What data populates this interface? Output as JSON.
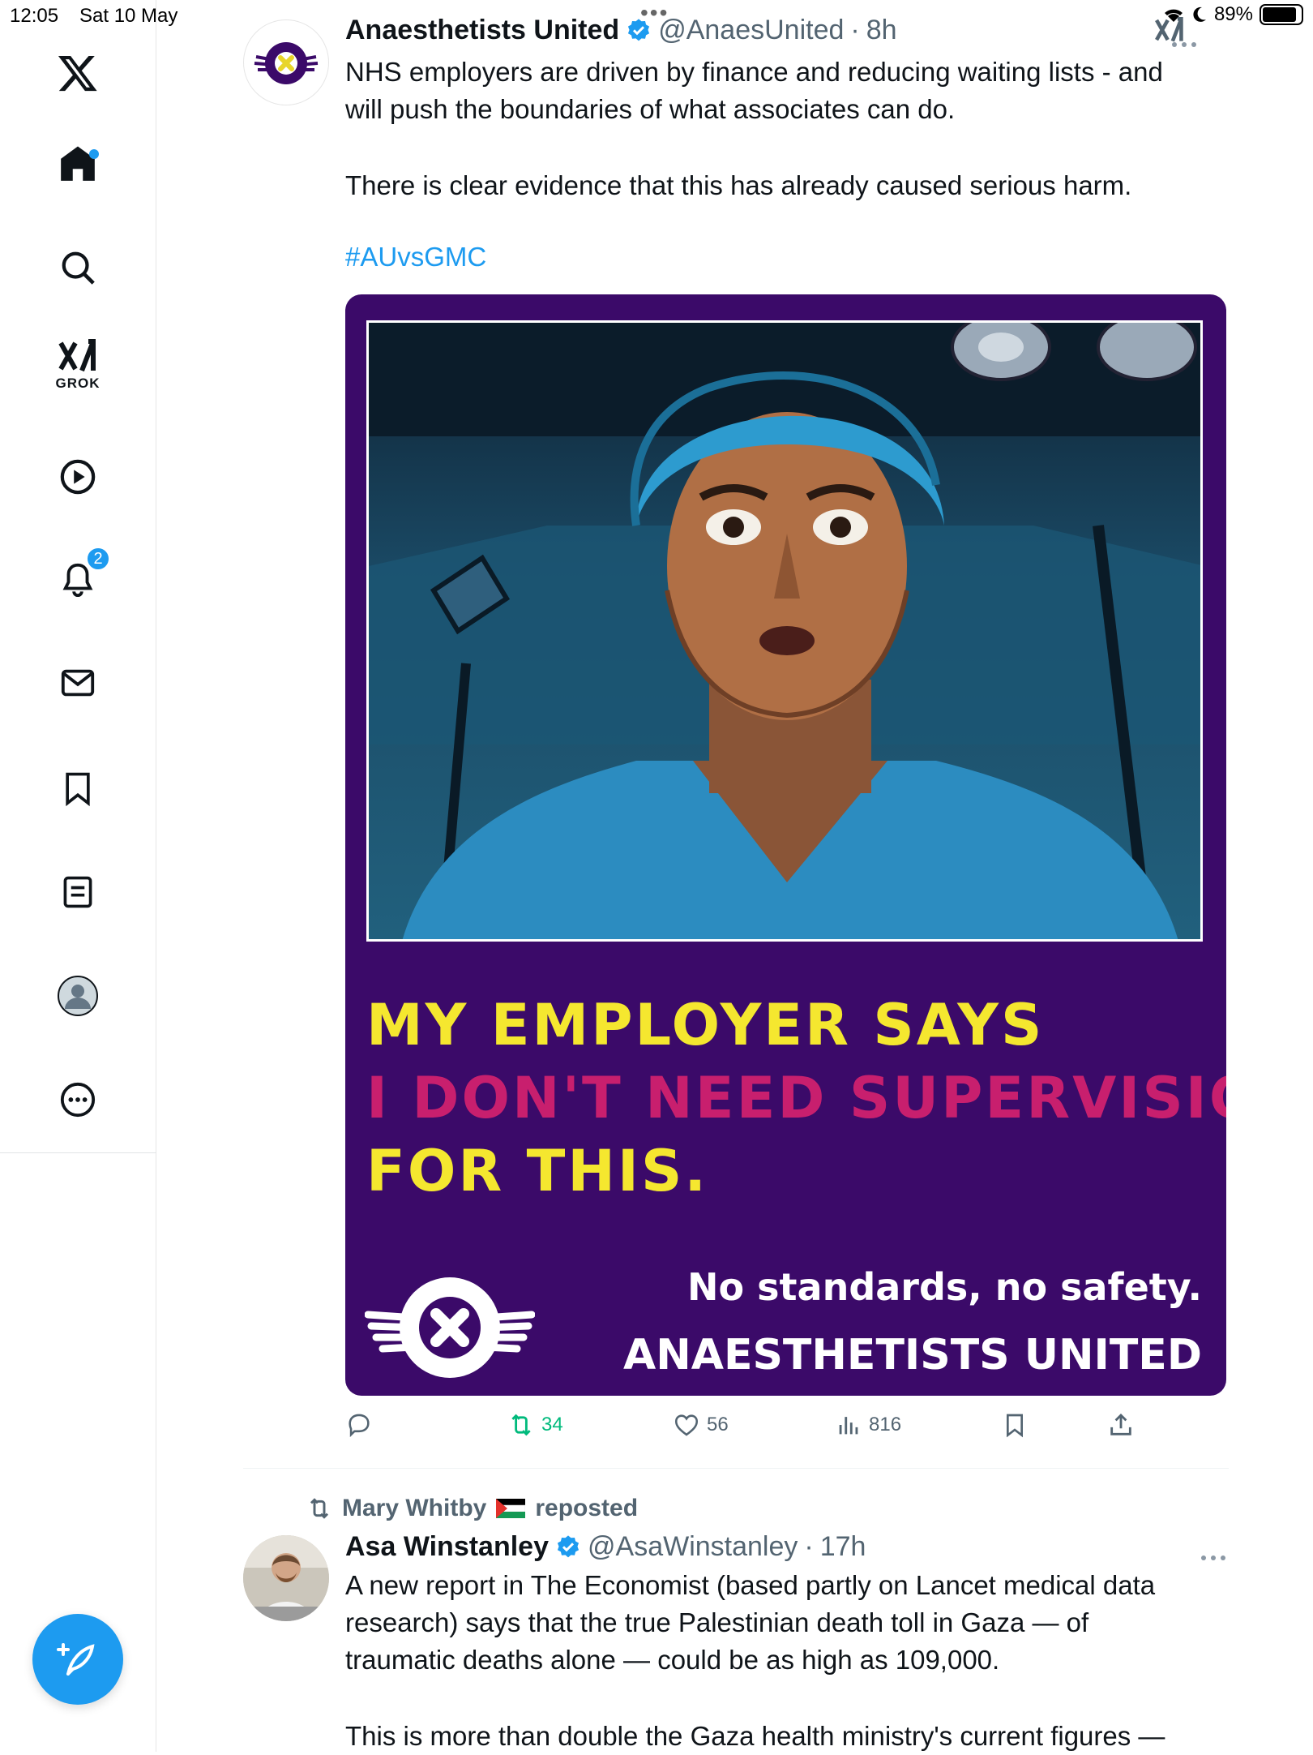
{
  "status_bar": {
    "time": "12:05",
    "date": "Sat 10 May",
    "battery": "89%",
    "battery_level": 0.89
  },
  "sidebar": {
    "logo": "x-logo-icon",
    "grok_label": "GROK",
    "notifications_badge": "2",
    "items": [
      {
        "name": "home",
        "icon": "home-icon"
      },
      {
        "name": "explore",
        "icon": "search-icon"
      },
      {
        "name": "grok",
        "icon": "grok-icon"
      },
      {
        "name": "video",
        "icon": "play-icon"
      },
      {
        "name": "notifications",
        "icon": "bell-icon"
      },
      {
        "name": "messages",
        "icon": "mail-icon"
      },
      {
        "name": "bookmarks",
        "icon": "bookmark-icon"
      },
      {
        "name": "lists",
        "icon": "list-icon"
      },
      {
        "name": "profile",
        "icon": "profile-icon"
      },
      {
        "name": "more",
        "icon": "more-circle-icon"
      }
    ],
    "compose": "compose-icon"
  },
  "tweet1": {
    "name": "Anaesthetists United",
    "handle": "@AnaesUnited",
    "time": "8h",
    "body1": "NHS employers are driven by finance and reducing waiting lists - and will push the boundaries of what associates can do.",
    "body2": "There is clear evidence that this has already caused serious harm.",
    "hashtag": "#AUvsGMC",
    "media": {
      "line1": "MY EMPLOYER SAYS",
      "line2": "I DON'T NEED SUPERVISION",
      "line3": "FOR THIS.",
      "tagline": "No standards,  no safety.",
      "brand": "ANAESTHETISTS UNITED",
      "colors": {
        "background": "#3b0a69",
        "yellow": "#f5e72f",
        "pink": "#c81f6e"
      }
    },
    "actions": {
      "retweets": "34",
      "likes": "56",
      "views": "816"
    }
  },
  "tweet2": {
    "repost_by": "Mary Whitby",
    "repost_label": "reposted",
    "name": "Asa Winstanley",
    "handle": "@AsaWinstanley",
    "time": "17h",
    "body1": "A new report in The Economist (based partly on Lancet medical data research) says that the true Palestinian death toll in Gaza — of traumatic deaths alone — could be as high as 109,000.",
    "body2": "This is more than double the Gaza health ministry's current figures —"
  }
}
